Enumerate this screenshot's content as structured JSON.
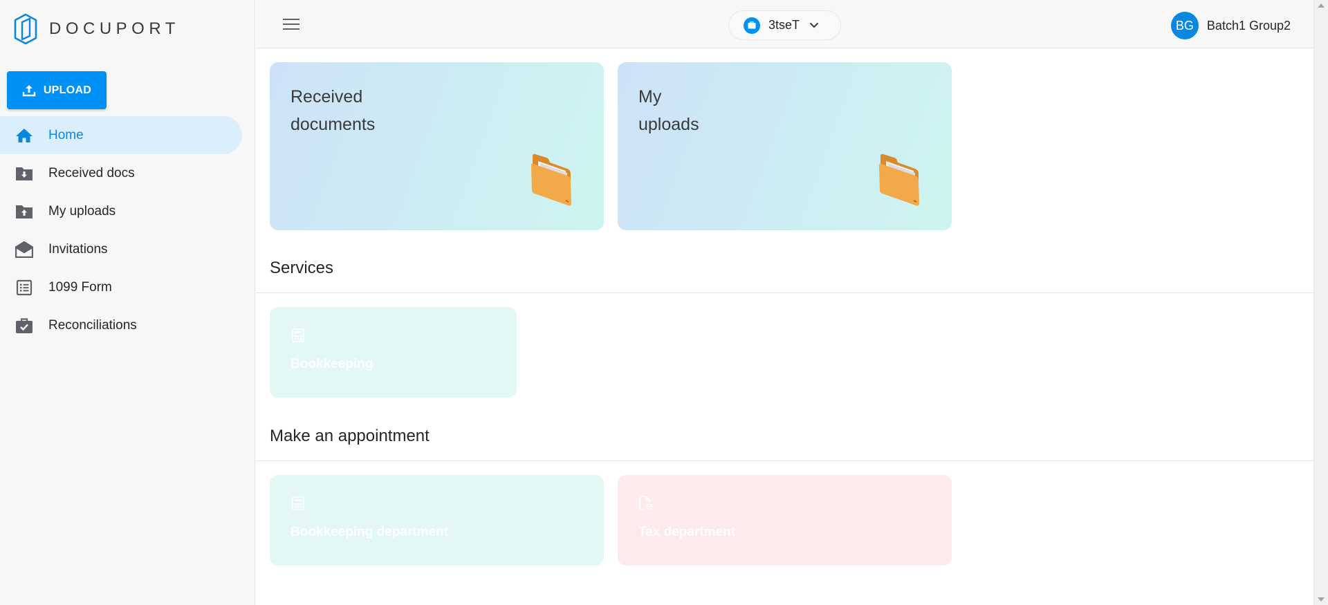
{
  "brand": {
    "name": "DOCUPORT",
    "logo_icon": "docuport-logo-icon",
    "accent": "#0091f7"
  },
  "sidebar": {
    "upload_label": "UPLOAD",
    "items": [
      {
        "label": "Home",
        "icon": "home-icon",
        "active": true
      },
      {
        "label": "Received docs",
        "icon": "folder-download-icon"
      },
      {
        "label": "My uploads",
        "icon": "folder-upload-icon"
      },
      {
        "label": "Invitations",
        "icon": "envelope-open-icon"
      },
      {
        "label": "1099 Form",
        "icon": "list-form-icon"
      },
      {
        "label": "Reconciliations",
        "icon": "briefcase-check-icon"
      }
    ]
  },
  "header": {
    "menu_icon": "hamburger-menu-icon",
    "company": {
      "name": "3tseT",
      "icon": "briefcase-icon"
    },
    "user": {
      "initials": "BG",
      "name": "Batch1 Group2"
    }
  },
  "main": {
    "cards": [
      {
        "title_line1": "Received",
        "title_line2": "documents",
        "icon": "folder-icon"
      },
      {
        "title_line1": "My",
        "title_line2": "uploads",
        "icon": "folder-icon"
      }
    ],
    "services": {
      "title": "Services",
      "items": [
        {
          "label": "Bookkeeping",
          "icon": "calculator-icon"
        }
      ]
    },
    "appointment": {
      "title": "Make an appointment",
      "items": [
        {
          "label": "Bookkeeping department",
          "icon": "calculator-icon"
        },
        {
          "label": "Tax department",
          "icon": "document-gear-icon"
        }
      ]
    }
  }
}
